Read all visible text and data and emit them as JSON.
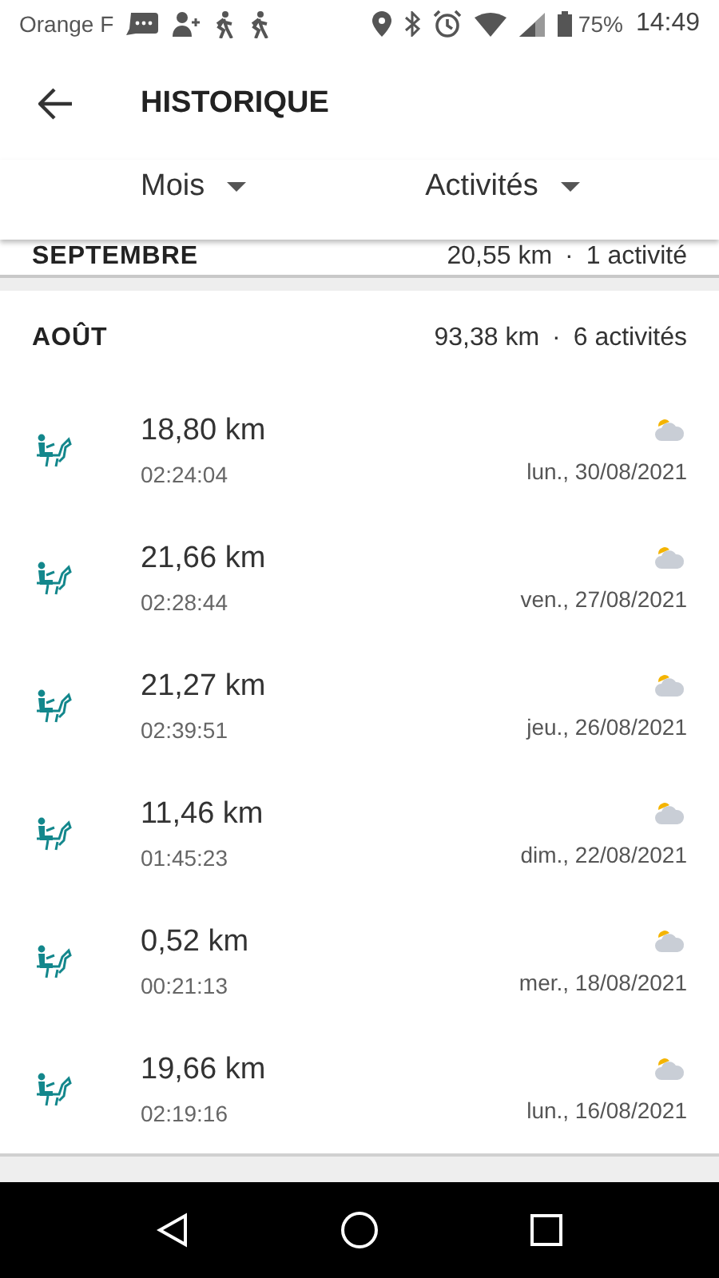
{
  "status_bar": {
    "carrier": "Orange F",
    "battery": "75%",
    "time": "14:49"
  },
  "header": {
    "title": "HISTORIQUE"
  },
  "filters": [
    {
      "label": "Mois"
    },
    {
      "label": "Activités"
    }
  ],
  "previous_month": {
    "name": "SEPTEMBRE",
    "distance": "20,55 km",
    "separator": "·",
    "count": "1 activité"
  },
  "month": {
    "name": "AOÛT",
    "distance": "93,38 km",
    "separator": "·",
    "count": "6 activités",
    "activities": [
      {
        "distance": "18,80 km",
        "duration": "02:24:04",
        "date": "lun., 30/08/2021"
      },
      {
        "distance": "21,66 km",
        "duration": "02:28:44",
        "date": "ven., 27/08/2021"
      },
      {
        "distance": "21,27 km",
        "duration": "02:39:51",
        "date": "jeu., 26/08/2021"
      },
      {
        "distance": "11,46 km",
        "duration": "01:45:23",
        "date": "dim., 22/08/2021"
      },
      {
        "distance": "0,52 km",
        "duration": "00:21:13",
        "date": "mer., 18/08/2021"
      },
      {
        "distance": "19,66 km",
        "duration": "02:19:16",
        "date": "lun., 16/08/2021"
      }
    ]
  }
}
